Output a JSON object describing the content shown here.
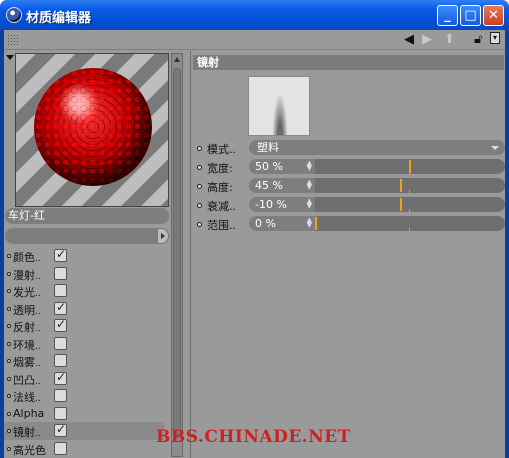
{
  "window": {
    "title": "材质编辑器",
    "buttons": {
      "minimize": "_",
      "maximize": "□",
      "close": "✕"
    }
  },
  "toolbar": {
    "icons": [
      "grip-icon",
      "arrow-left-icon",
      "arrow-right-icon",
      "arrow-up-icon",
      "lock-icon",
      "menu-icon"
    ]
  },
  "material": {
    "name": "车灯-红",
    "preview_arrow": "▼"
  },
  "channels": [
    {
      "label": "颜色",
      "checked": true
    },
    {
      "label": "漫射",
      "checked": false
    },
    {
      "label": "发光",
      "checked": false
    },
    {
      "label": "透明",
      "checked": true
    },
    {
      "label": "反射",
      "checked": true
    },
    {
      "label": "环境",
      "checked": false
    },
    {
      "label": "烟雾",
      "checked": false
    },
    {
      "label": "凹凸",
      "checked": true
    },
    {
      "label": "法线",
      "checked": false
    },
    {
      "label": "Alpha",
      "checked": false
    },
    {
      "label": "镜射",
      "checked": true,
      "selected": true
    },
    {
      "label": "高光色",
      "checked": false
    }
  ],
  "channel_suffix": "..",
  "panel": {
    "section_title": "镜射",
    "mode": {
      "label": "模式",
      "suffix": "..",
      "value": "塑料"
    },
    "width": {
      "label": "宽度",
      "suffix": ":",
      "value": "50 %",
      "level": 0.5
    },
    "height": {
      "label": "高度",
      "suffix": ":",
      "value": "45 %",
      "level": 0.45
    },
    "falloff": {
      "label": "衰减",
      "suffix": "..",
      "value": "-10 %",
      "level": 0.45
    },
    "range": {
      "label": "范围",
      "suffix": "..",
      "value": "0 %",
      "level": 0.0
    }
  },
  "watermark": "BBS.CHINADE.NET",
  "colors": {
    "titlebar": "#0a5ce8",
    "slider_mark": "#f0a020",
    "watermark": "#d02020"
  }
}
